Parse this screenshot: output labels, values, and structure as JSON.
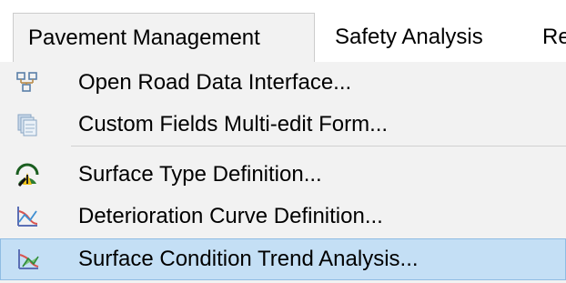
{
  "menubar": {
    "items": [
      {
        "label": "Pavement Management"
      },
      {
        "label": "Safety Analysis"
      },
      {
        "label": "Rep"
      }
    ]
  },
  "dropdown": {
    "items": [
      {
        "label": "Open Road Data Interface...",
        "icon": "road-data-grid-icon"
      },
      {
        "label": "Custom Fields Multi-edit Form...",
        "icon": "stacked-forms-icon"
      },
      {
        "label": "Surface Type Definition...",
        "icon": "road-surface-icon"
      },
      {
        "label": "Deterioration Curve Definition...",
        "icon": "curve-chart-icon"
      },
      {
        "label": "Surface Condition Trend Analysis...",
        "icon": "trend-chart-icon"
      }
    ],
    "highlighted_index": 4
  },
  "colors": {
    "dropdown_bg": "#f2f2f2",
    "highlight_bg": "#c4dff5",
    "highlight_border": "#8fbce3"
  }
}
